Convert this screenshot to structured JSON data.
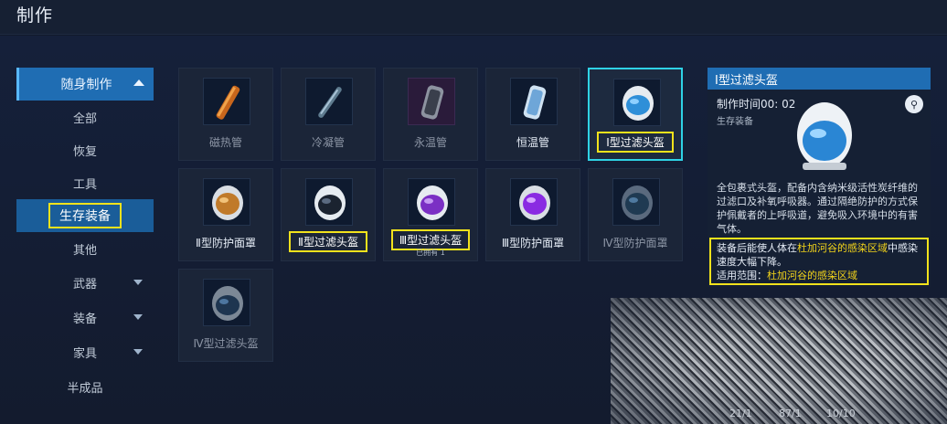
{
  "header": {
    "title": "制作"
  },
  "sidebar": {
    "section": "随身制作",
    "items": [
      "全部",
      "恢复",
      "工具",
      "生存装备",
      "其他"
    ],
    "active_item": "生存装备",
    "groups": [
      "武器",
      "装备",
      "家具"
    ],
    "footer_item": "半成品"
  },
  "grid": [
    {
      "label": "磁热管",
      "sub": ""
    },
    {
      "label": "冷凝管",
      "sub": ""
    },
    {
      "label": "永温管",
      "sub": ""
    },
    {
      "label": "恒温管",
      "sub": ""
    },
    {
      "label": "I型过滤头盔",
      "sub": ""
    },
    {
      "label": "Ⅱ型防护面罩",
      "sub": ""
    },
    {
      "label": "Ⅱ型过滤头盔",
      "sub": ""
    },
    {
      "label": "Ⅲ型过滤头盔",
      "sub": "已拥有 1"
    },
    {
      "label": "Ⅲ型防护面罩",
      "sub": ""
    },
    {
      "label": "Ⅳ型防护面罩",
      "sub": ""
    },
    {
      "label": "Ⅳ型过滤头盔",
      "sub": ""
    }
  ],
  "detail": {
    "title": "I型过滤头盔",
    "craft_time": "制作时间00: 02",
    "category": "生存装备",
    "description": "全包裹式头盔，配备内含纳米级活性炭纤维的过滤口及补氧呼吸器。通过隔绝防护的方式保护佩戴者的上呼吸道，避免吸入环境中的有害气体。",
    "effect_prefix": "装备后能使人体在",
    "effect_zone": "杜加河谷的感染区域",
    "effect_suffix": "中感染速度大幅下降。",
    "scope_label": "适用范围：",
    "scope_value": "杜加河谷的感染区域"
  },
  "counters": [
    "21/1",
    "87/1",
    "10/10"
  ],
  "colors": {
    "accent_blue": "#1f6db3",
    "highlight_yellow": "#f2e21c",
    "selected_cyan": "#2fd2e6"
  }
}
